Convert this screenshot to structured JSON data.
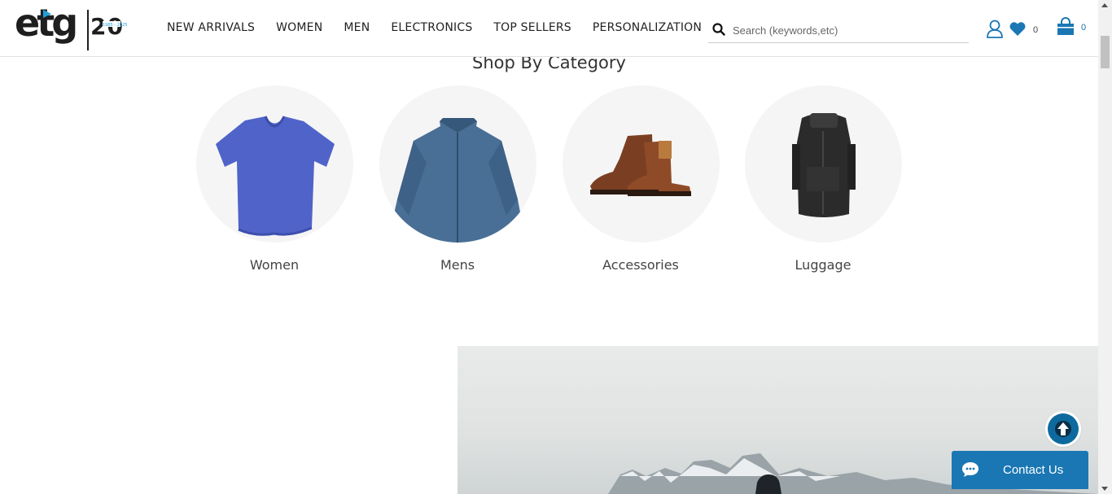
{
  "brand": {
    "logo_text": "etg",
    "logo_number": "20",
    "logo_tagline": "1985 - 2025"
  },
  "nav": {
    "items": [
      {
        "label": "NEW ARRIVALS"
      },
      {
        "label": "WOMEN"
      },
      {
        "label": "MEN"
      },
      {
        "label": "ELECTRONICS"
      },
      {
        "label": "TOP SELLERS"
      },
      {
        "label": "PERSONALIZATION"
      }
    ]
  },
  "search": {
    "placeholder": "Search (keywords,etc)",
    "value": ""
  },
  "header_actions": {
    "account_icon": "user-icon",
    "wishlist_icon": "heart-icon",
    "wishlist_count": "0",
    "cart_icon": "shopping-bag-icon",
    "cart_count": "0"
  },
  "category_section": {
    "title": "Shop By Category",
    "categories": [
      {
        "label": "Women",
        "image": "blue-tshirt"
      },
      {
        "label": "Mens",
        "image": "blue-jacket"
      },
      {
        "label": "Accessories",
        "image": "brown-boots"
      },
      {
        "label": "Luggage",
        "image": "black-backpack"
      }
    ]
  },
  "banner": {
    "image": "snowy-mountains-hiker"
  },
  "floating": {
    "back_to_top_icon": "arrow-up-icon",
    "contact_label": "Contact Us",
    "contact_icon": "chat-icon"
  },
  "colors": {
    "accent": "#1a77b4",
    "back_to_top": "#0e6a9e",
    "text": "#333333"
  }
}
